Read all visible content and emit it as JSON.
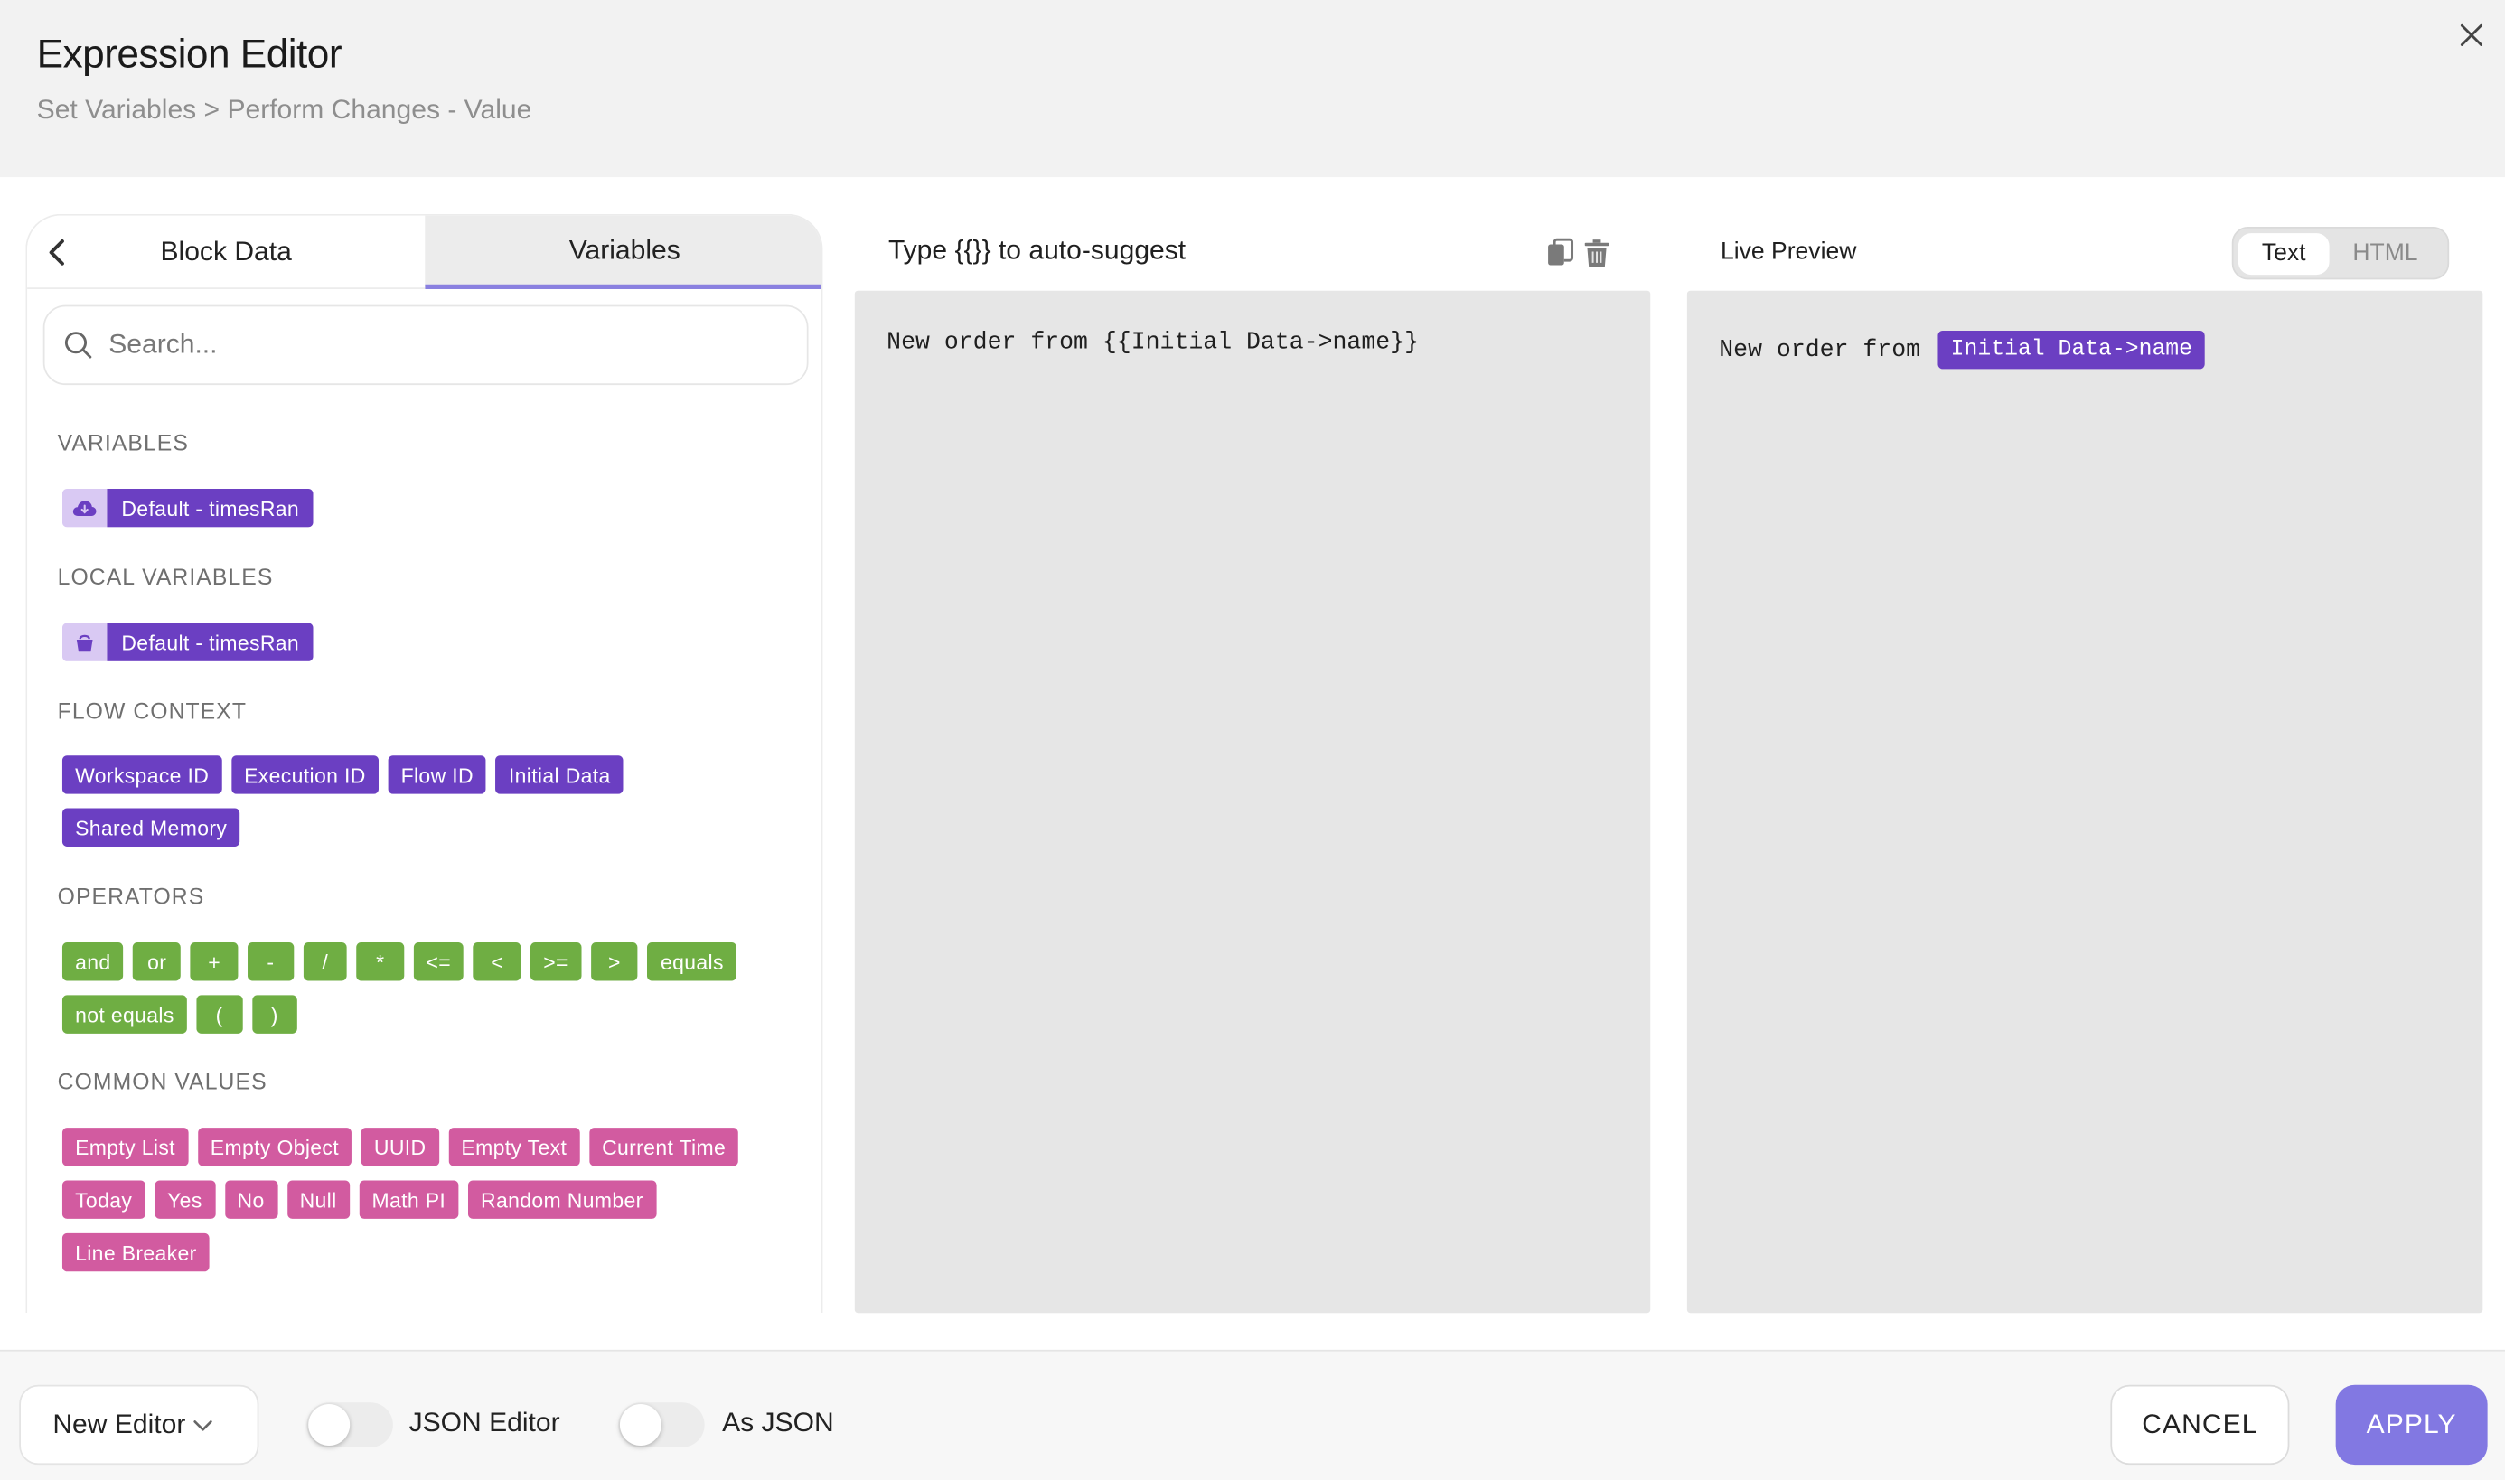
{
  "dialog": {
    "title": "Expression Editor",
    "breadcrumb": "Set Variables > Perform Changes - Value"
  },
  "left_panel": {
    "tabs": [
      {
        "label": "Block Data",
        "active": false
      },
      {
        "label": "Variables",
        "active": true
      }
    ],
    "search_placeholder": "Search...",
    "sections": {
      "variables": {
        "label": "VARIABLES",
        "items": [
          {
            "label": "Default - timesRan",
            "icon": "cloud-download-icon"
          }
        ]
      },
      "local_variables": {
        "label": "LOCAL VARIABLES",
        "items": [
          {
            "label": "Default - timesRan",
            "icon": "bucket-icon"
          }
        ]
      },
      "flow_context": {
        "label": "FLOW CONTEXT",
        "rows": [
          [
            "Workspace ID",
            "Execution ID",
            "Flow ID",
            "Initial Data"
          ],
          [
            "Shared Memory"
          ]
        ]
      },
      "operators": {
        "label": "OPERATORS",
        "rows": [
          [
            "and",
            "or",
            "+",
            "-",
            "/",
            "*",
            "<=",
            "<",
            ">=",
            ">",
            "equals"
          ],
          [
            "not equals",
            "(",
            ")"
          ]
        ]
      },
      "common_values": {
        "label": "COMMON VALUES",
        "rows": [
          [
            "Empty List",
            "Empty Object",
            "UUID",
            "Empty Text",
            "Current Time"
          ],
          [
            "Today",
            "Yes",
            "No",
            "Null",
            "Math PI",
            "Random Number"
          ],
          [
            "Line Breaker"
          ]
        ]
      }
    }
  },
  "editor": {
    "hint": "Type {{}} to auto-suggest",
    "content": "New order from {{Initial Data->name}}"
  },
  "preview": {
    "label": "Live Preview",
    "modes": [
      {
        "label": "Text",
        "active": true
      },
      {
        "label": "HTML",
        "active": false
      }
    ],
    "text": "New order from",
    "chip": "Initial Data->name"
  },
  "footer": {
    "editor_select": "New Editor",
    "json_editor_label": "JSON Editor",
    "as_json_label": "As JSON",
    "cancel_label": "CANCEL",
    "apply_label": "APPLY"
  },
  "colors": {
    "purple_chip": "#6b3fc2",
    "green_chip": "#6fae43",
    "pink_chip": "#d25ba0",
    "accent": "#8278e2"
  }
}
